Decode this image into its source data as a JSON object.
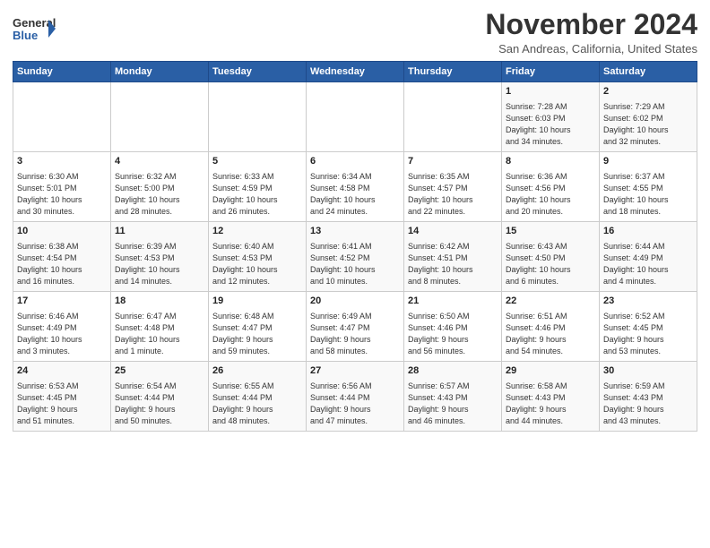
{
  "header": {
    "logo_line1": "General",
    "logo_line2": "Blue",
    "month": "November 2024",
    "location": "San Andreas, California, United States"
  },
  "days_of_week": [
    "Sunday",
    "Monday",
    "Tuesday",
    "Wednesday",
    "Thursday",
    "Friday",
    "Saturday"
  ],
  "weeks": [
    [
      {
        "day": "",
        "info": ""
      },
      {
        "day": "",
        "info": ""
      },
      {
        "day": "",
        "info": ""
      },
      {
        "day": "",
        "info": ""
      },
      {
        "day": "",
        "info": ""
      },
      {
        "day": "1",
        "info": "Sunrise: 7:28 AM\nSunset: 6:03 PM\nDaylight: 10 hours\nand 34 minutes."
      },
      {
        "day": "2",
        "info": "Sunrise: 7:29 AM\nSunset: 6:02 PM\nDaylight: 10 hours\nand 32 minutes."
      }
    ],
    [
      {
        "day": "3",
        "info": "Sunrise: 6:30 AM\nSunset: 5:01 PM\nDaylight: 10 hours\nand 30 minutes."
      },
      {
        "day": "4",
        "info": "Sunrise: 6:32 AM\nSunset: 5:00 PM\nDaylight: 10 hours\nand 28 minutes."
      },
      {
        "day": "5",
        "info": "Sunrise: 6:33 AM\nSunset: 4:59 PM\nDaylight: 10 hours\nand 26 minutes."
      },
      {
        "day": "6",
        "info": "Sunrise: 6:34 AM\nSunset: 4:58 PM\nDaylight: 10 hours\nand 24 minutes."
      },
      {
        "day": "7",
        "info": "Sunrise: 6:35 AM\nSunset: 4:57 PM\nDaylight: 10 hours\nand 22 minutes."
      },
      {
        "day": "8",
        "info": "Sunrise: 6:36 AM\nSunset: 4:56 PM\nDaylight: 10 hours\nand 20 minutes."
      },
      {
        "day": "9",
        "info": "Sunrise: 6:37 AM\nSunset: 4:55 PM\nDaylight: 10 hours\nand 18 minutes."
      }
    ],
    [
      {
        "day": "10",
        "info": "Sunrise: 6:38 AM\nSunset: 4:54 PM\nDaylight: 10 hours\nand 16 minutes."
      },
      {
        "day": "11",
        "info": "Sunrise: 6:39 AM\nSunset: 4:53 PM\nDaylight: 10 hours\nand 14 minutes."
      },
      {
        "day": "12",
        "info": "Sunrise: 6:40 AM\nSunset: 4:53 PM\nDaylight: 10 hours\nand 12 minutes."
      },
      {
        "day": "13",
        "info": "Sunrise: 6:41 AM\nSunset: 4:52 PM\nDaylight: 10 hours\nand 10 minutes."
      },
      {
        "day": "14",
        "info": "Sunrise: 6:42 AM\nSunset: 4:51 PM\nDaylight: 10 hours\nand 8 minutes."
      },
      {
        "day": "15",
        "info": "Sunrise: 6:43 AM\nSunset: 4:50 PM\nDaylight: 10 hours\nand 6 minutes."
      },
      {
        "day": "16",
        "info": "Sunrise: 6:44 AM\nSunset: 4:49 PM\nDaylight: 10 hours\nand 4 minutes."
      }
    ],
    [
      {
        "day": "17",
        "info": "Sunrise: 6:46 AM\nSunset: 4:49 PM\nDaylight: 10 hours\nand 3 minutes."
      },
      {
        "day": "18",
        "info": "Sunrise: 6:47 AM\nSunset: 4:48 PM\nDaylight: 10 hours\nand 1 minute."
      },
      {
        "day": "19",
        "info": "Sunrise: 6:48 AM\nSunset: 4:47 PM\nDaylight: 9 hours\nand 59 minutes."
      },
      {
        "day": "20",
        "info": "Sunrise: 6:49 AM\nSunset: 4:47 PM\nDaylight: 9 hours\nand 58 minutes."
      },
      {
        "day": "21",
        "info": "Sunrise: 6:50 AM\nSunset: 4:46 PM\nDaylight: 9 hours\nand 56 minutes."
      },
      {
        "day": "22",
        "info": "Sunrise: 6:51 AM\nSunset: 4:46 PM\nDaylight: 9 hours\nand 54 minutes."
      },
      {
        "day": "23",
        "info": "Sunrise: 6:52 AM\nSunset: 4:45 PM\nDaylight: 9 hours\nand 53 minutes."
      }
    ],
    [
      {
        "day": "24",
        "info": "Sunrise: 6:53 AM\nSunset: 4:45 PM\nDaylight: 9 hours\nand 51 minutes."
      },
      {
        "day": "25",
        "info": "Sunrise: 6:54 AM\nSunset: 4:44 PM\nDaylight: 9 hours\nand 50 minutes."
      },
      {
        "day": "26",
        "info": "Sunrise: 6:55 AM\nSunset: 4:44 PM\nDaylight: 9 hours\nand 48 minutes."
      },
      {
        "day": "27",
        "info": "Sunrise: 6:56 AM\nSunset: 4:44 PM\nDaylight: 9 hours\nand 47 minutes."
      },
      {
        "day": "28",
        "info": "Sunrise: 6:57 AM\nSunset: 4:43 PM\nDaylight: 9 hours\nand 46 minutes."
      },
      {
        "day": "29",
        "info": "Sunrise: 6:58 AM\nSunset: 4:43 PM\nDaylight: 9 hours\nand 44 minutes."
      },
      {
        "day": "30",
        "info": "Sunrise: 6:59 AM\nSunset: 4:43 PM\nDaylight: 9 hours\nand 43 minutes."
      }
    ]
  ]
}
